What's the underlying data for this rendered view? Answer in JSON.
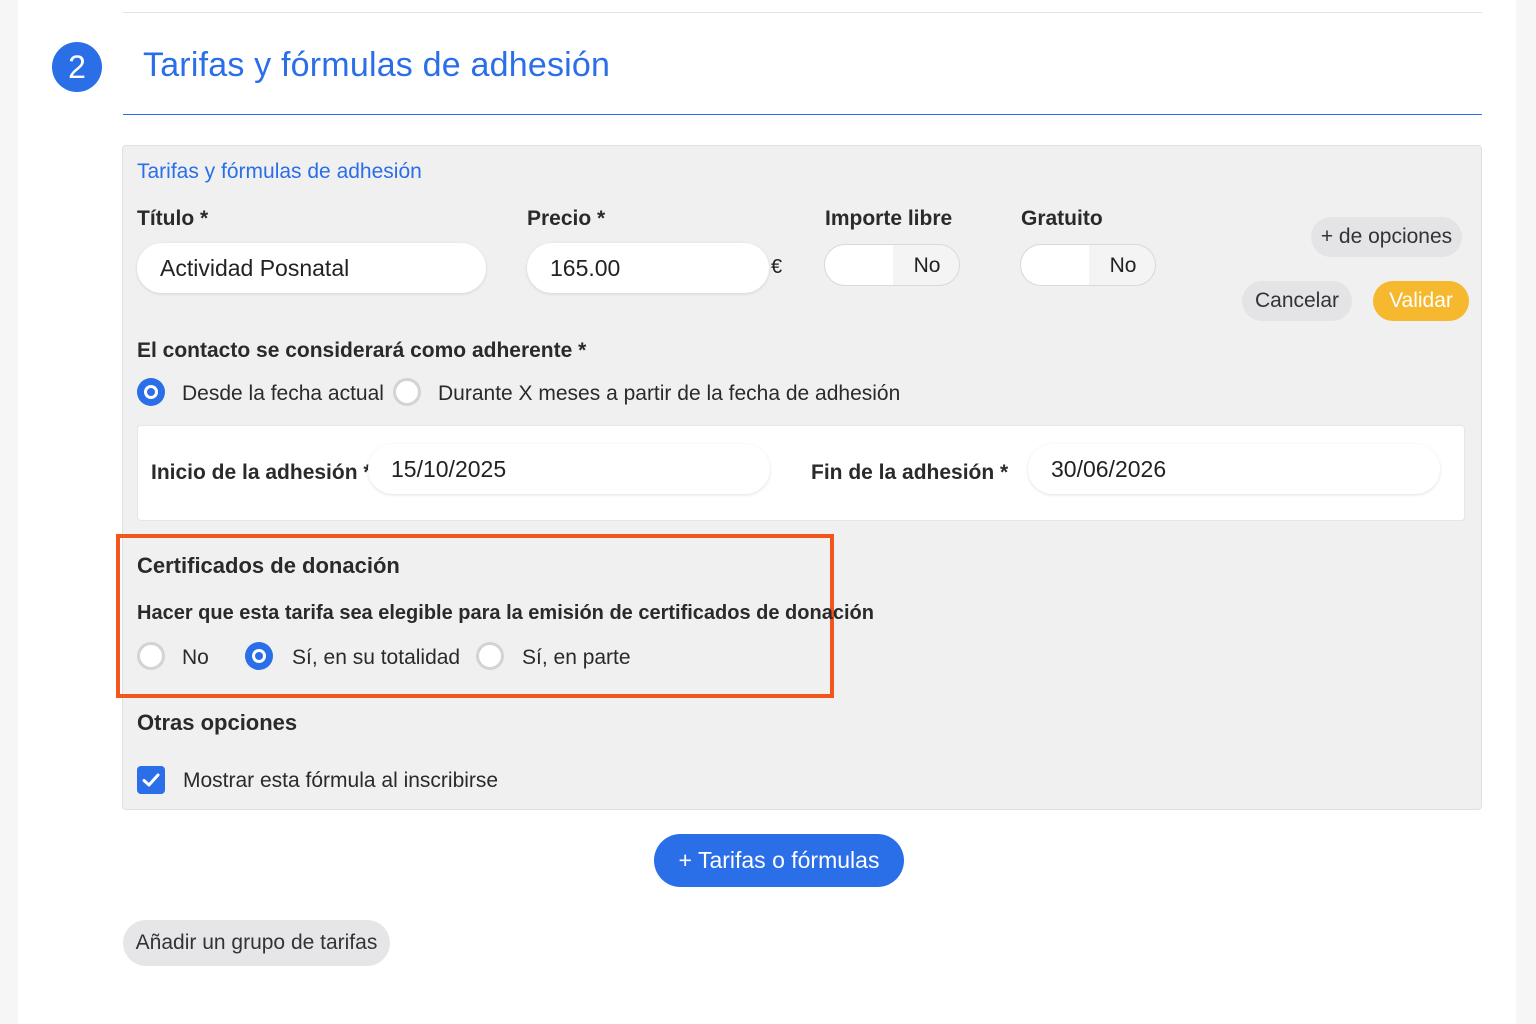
{
  "step": {
    "number": "2",
    "title": "Tarifas y fórmulas de adhesión"
  },
  "panel": {
    "title": "Tarifas y fórmulas de adhesión",
    "titulo": {
      "label": "Título *",
      "value": "Actividad Posnatal"
    },
    "precio": {
      "label": "Precio *",
      "value": "165.00",
      "currency": "€"
    },
    "importe_libre": {
      "label": "Importe libre",
      "value": "No"
    },
    "gratuito": {
      "label": "Gratuito",
      "value": "No"
    },
    "buttons": {
      "options": "+ de opciones",
      "cancel": "Cancelar",
      "validate": "Validar"
    },
    "adherente": {
      "label": "El contacto se considerará como adherente *",
      "options": [
        "Desde la fecha actual",
        "Durante X meses a partir de la fecha de adhesión"
      ],
      "selected": "Desde la fecha actual"
    },
    "dates": {
      "start_label": "Inicio de la adhesión *",
      "start_value": "15/10/2025",
      "end_label": "Fin de la adhesión *",
      "end_value": "30/06/2026"
    },
    "donation": {
      "heading": "Certificados de donación",
      "question": "Hacer que esta tarifa sea elegible para la emisión de certificados de donación",
      "options": [
        "No",
        "Sí, en su totalidad",
        "Sí, en parte"
      ],
      "selected": "Sí, en su totalidad",
      "highlight_color": "#f2561d"
    },
    "other": {
      "heading": "Otras opciones",
      "checkbox_label": "Mostrar esta fórmula al inscribirse",
      "checked": true
    }
  },
  "actions": {
    "add_tariff": "+ Tarifas o fórmulas",
    "add_group": "Añadir un grupo de tarifas"
  },
  "colors": {
    "accent": "#2a6ee8",
    "validate": "#f5b82e"
  }
}
